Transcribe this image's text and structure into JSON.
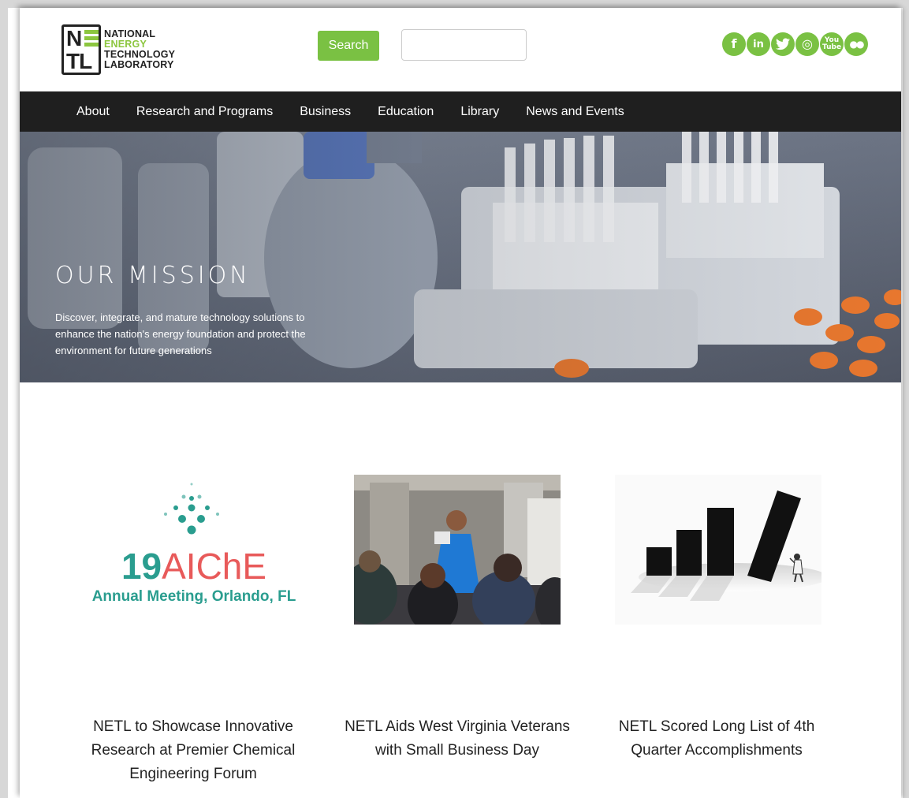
{
  "header": {
    "logo": {
      "mark_n": "N",
      "mark_tl": "TL",
      "line1": "NATIONAL",
      "line2": "ENERGY",
      "line3": "TECHNOLOGY",
      "line4": "LABORATORY"
    },
    "search_label": "Search",
    "search_placeholder": "",
    "social": [
      {
        "icon": "facebook-icon",
        "glyph": "f"
      },
      {
        "icon": "linkedin-icon",
        "glyph": "in"
      },
      {
        "icon": "twitter-icon",
        "glyph": "🐦"
      },
      {
        "icon": "instagram-icon",
        "glyph": "◎"
      },
      {
        "icon": "youtube-icon",
        "glyph": "You Tube"
      },
      {
        "icon": "flickr-icon",
        "glyph": "●●"
      }
    ]
  },
  "nav": {
    "items": [
      "About",
      "Research and Programs",
      "Business",
      "Education",
      "Library",
      "News and Events"
    ]
  },
  "hero": {
    "title": "OUR MISSION",
    "text": "Discover, integrate, and mature technology solutions to enhance the nation's energy foundation and protect the environment for future generations"
  },
  "news": [
    {
      "image_text_number": "19",
      "image_text_org": "AIChE",
      "image_text_sub": "Annual Meeting, Orlando, FL",
      "title": "NETL to Showcase Innovative Research at Premier Chemical Engineering Forum"
    },
    {
      "title": "NETL Aids West Virginia Veterans with Small Business Day"
    },
    {
      "title": "NETL Scored Long List of 4th Quarter Accomplishments"
    }
  ],
  "colors": {
    "accent": "#7ac143",
    "nav_bg": "#1f1f1f",
    "aiche_teal": "#2a9d8f",
    "aiche_red": "#e85a5a"
  }
}
